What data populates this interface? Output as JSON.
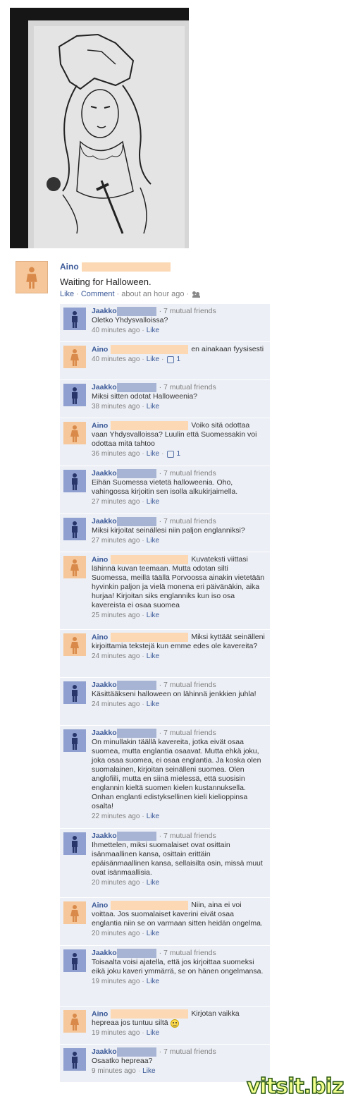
{
  "photo": {
    "alt_name": "drawing-photo"
  },
  "post": {
    "author": "Aino",
    "text": "Waiting for Halloween.",
    "like_label": "Like",
    "comment_label": "Comment",
    "timestamp": "about an hour ago"
  },
  "comments": [
    {
      "author": "Jaakko",
      "gender": "male",
      "mutual": "7 mutual friends",
      "text": "Oletko Yhdysvalloissa?",
      "time": "40 minutes ago",
      "like": "Like",
      "likes": ""
    },
    {
      "author": "Aino",
      "gender": "female",
      "mutual": "",
      "text": "en ainakaan fyysisesti",
      "time": "40 minutes ago",
      "like": "Like",
      "likes": "1"
    },
    {
      "author": "Jaakko",
      "gender": "male",
      "mutual": "7 mutual friends",
      "text": "Miksi sitten odotat Halloweenia?",
      "time": "38 minutes ago",
      "like": "Like",
      "likes": ""
    },
    {
      "author": "Aino",
      "gender": "female",
      "mutual": "",
      "text": "Voiko sitä odottaa vaan Yhdysvalloissa? Luulin että Suomessakin voi odottaa mitä tahtoo",
      "time": "36 minutes ago",
      "like": "Like",
      "likes": "1"
    },
    {
      "author": "Jaakko",
      "gender": "male",
      "mutual": "7 mutual friends",
      "text": "Eihän Suomessa vietetä halloweenia. Oho, vahingossa kirjoitin sen isolla alkukirjaimella.",
      "time": "27 minutes ago",
      "like": "Like",
      "likes": ""
    },
    {
      "author": "Jaakko",
      "gender": "male",
      "mutual": "7 mutual friends",
      "text": "Miksi kirjoitat seinällesi niin paljon englanniksi?",
      "time": "27 minutes ago",
      "like": "Like",
      "likes": ""
    },
    {
      "author": "Aino",
      "gender": "female",
      "mutual": "",
      "text": "Kuvateksti viittasi lähinnä kuvan teemaan. Mutta odotan silti Suomessa, meillä täällä Porvoossa ainakin vietetään hyvinkin paljon ja vielä monena eri päivänäkin, aika hurjaa! Kirjoitan siks englanniks kun iso osa kavereista ei osaa suomea",
      "time": "25 minutes ago",
      "like": "Like",
      "likes": ""
    },
    {
      "author": "Aino",
      "gender": "female",
      "mutual": "",
      "text": "Miksi kyttäät seinälleni kirjoittamia tekstejä kun emme edes ole kavereita?",
      "time": "24 minutes ago",
      "like": "Like",
      "likes": ""
    },
    {
      "author": "Jaakko",
      "gender": "male",
      "mutual": "7 mutual friends",
      "text": "Käsittääkseni halloween on lähinnä jenkkien juhla!",
      "time": "24 minutes ago",
      "like": "Like",
      "likes": ""
    },
    {
      "author": "Jaakko",
      "gender": "male",
      "mutual": "7 mutual friends",
      "text": "On minullakin täällä kavereita, jotka eivät osaa suomea, mutta englantia osaavat. Mutta ehkä joku, joka osaa suomea, ei osaa englantia. Ja koska olen suomalainen, kirjoitan seinälleni suomea. Olen anglofiili, mutta en siinä mielessä, että suosisin englannin kieltä suomen kielen kustannuksella. Onhan englanti edistyksellinen kieli kielioppinsa osalta!",
      "time": "22 minutes ago",
      "like": "Like",
      "likes": ""
    },
    {
      "author": "Jaakko",
      "gender": "male",
      "mutual": "7 mutual friends",
      "text": "Ihmettelen, miksi suomalaiset ovat osittain isänmaallinen kansa, osittain erittäin epäisänmaallinen kansa, sellaisilta osin, missä muut ovat isänmaallisia.",
      "time": "20 minutes ago",
      "like": "Like",
      "likes": ""
    },
    {
      "author": "Aino",
      "gender": "female",
      "mutual": "",
      "text": "Niin, aina ei voi voittaa. Jos suomalaiset kaverini eivät osaa englantia niin se on varmaan sitten heidän ongelma.",
      "time": "20 minutes ago",
      "like": "Like",
      "likes": ""
    },
    {
      "author": "Jaakko",
      "gender": "male",
      "mutual": "7 mutual friends",
      "text": "Toisaalta voisi ajatella, että jos kirjoittaa suomeksi eikä joku kaveri ymmärrä, se on hänen ongelmansa.",
      "time": "19 minutes ago",
      "like": "Like",
      "likes": ""
    },
    {
      "author": "Aino",
      "gender": "female",
      "mutual": "",
      "text": "Kirjotan vaikka hepreaa jos tuntuu siltä",
      "time": "19 minutes ago",
      "like": "Like",
      "likes": "",
      "smiley": true
    },
    {
      "author": "Jaakko",
      "gender": "male",
      "mutual": "7 mutual friends",
      "text": "Osaatko hepreaa?",
      "time": "9 minutes ago",
      "like": "Like",
      "likes": ""
    }
  ],
  "watermark": {
    "text": "vitsit.biz"
  }
}
